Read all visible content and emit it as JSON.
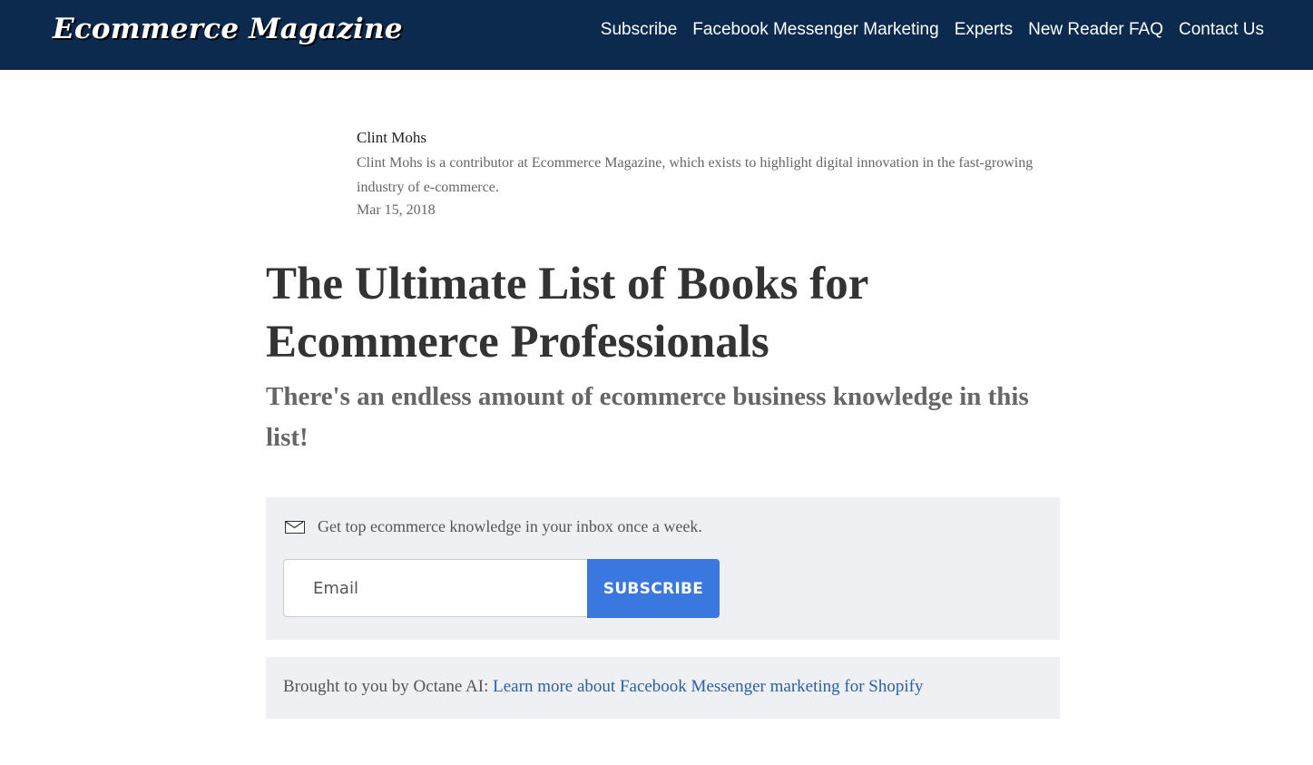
{
  "site": {
    "logo_text": "Ecommerce Magazine",
    "brand_color": "#0b2a4d"
  },
  "nav": {
    "items": [
      {
        "label": "Subscribe"
      },
      {
        "label": "Facebook Messenger Marketing"
      },
      {
        "label": "Experts"
      },
      {
        "label": "New Reader FAQ"
      },
      {
        "label": "Contact Us"
      }
    ]
  },
  "author": {
    "name": "Clint Mohs",
    "bio": "Clint Mohs is a contributor at Ecommerce Magazine, which exists to highlight digital innovation in the fast-growing industry of e-commerce.",
    "date": "Mar 15, 2018"
  },
  "article": {
    "title": "The Ultimate List of Books for Ecommerce Professionals",
    "subtitle": "There's an endless amount of ecommerce business knowledge in this list!"
  },
  "newsletter": {
    "icon": "envelope-icon",
    "message": "Get top ecommerce knowledge in your inbox once a week.",
    "email_placeholder": "Email",
    "email_value": "",
    "button_label": "SUBSCRIBE",
    "button_color": "#3a78e0"
  },
  "sponsor": {
    "prefix": "Brought to you by Octane AI: ",
    "link_text": "Learn more about Facebook Messenger marketing for Shopify",
    "link_color": "#2b5fa6"
  }
}
